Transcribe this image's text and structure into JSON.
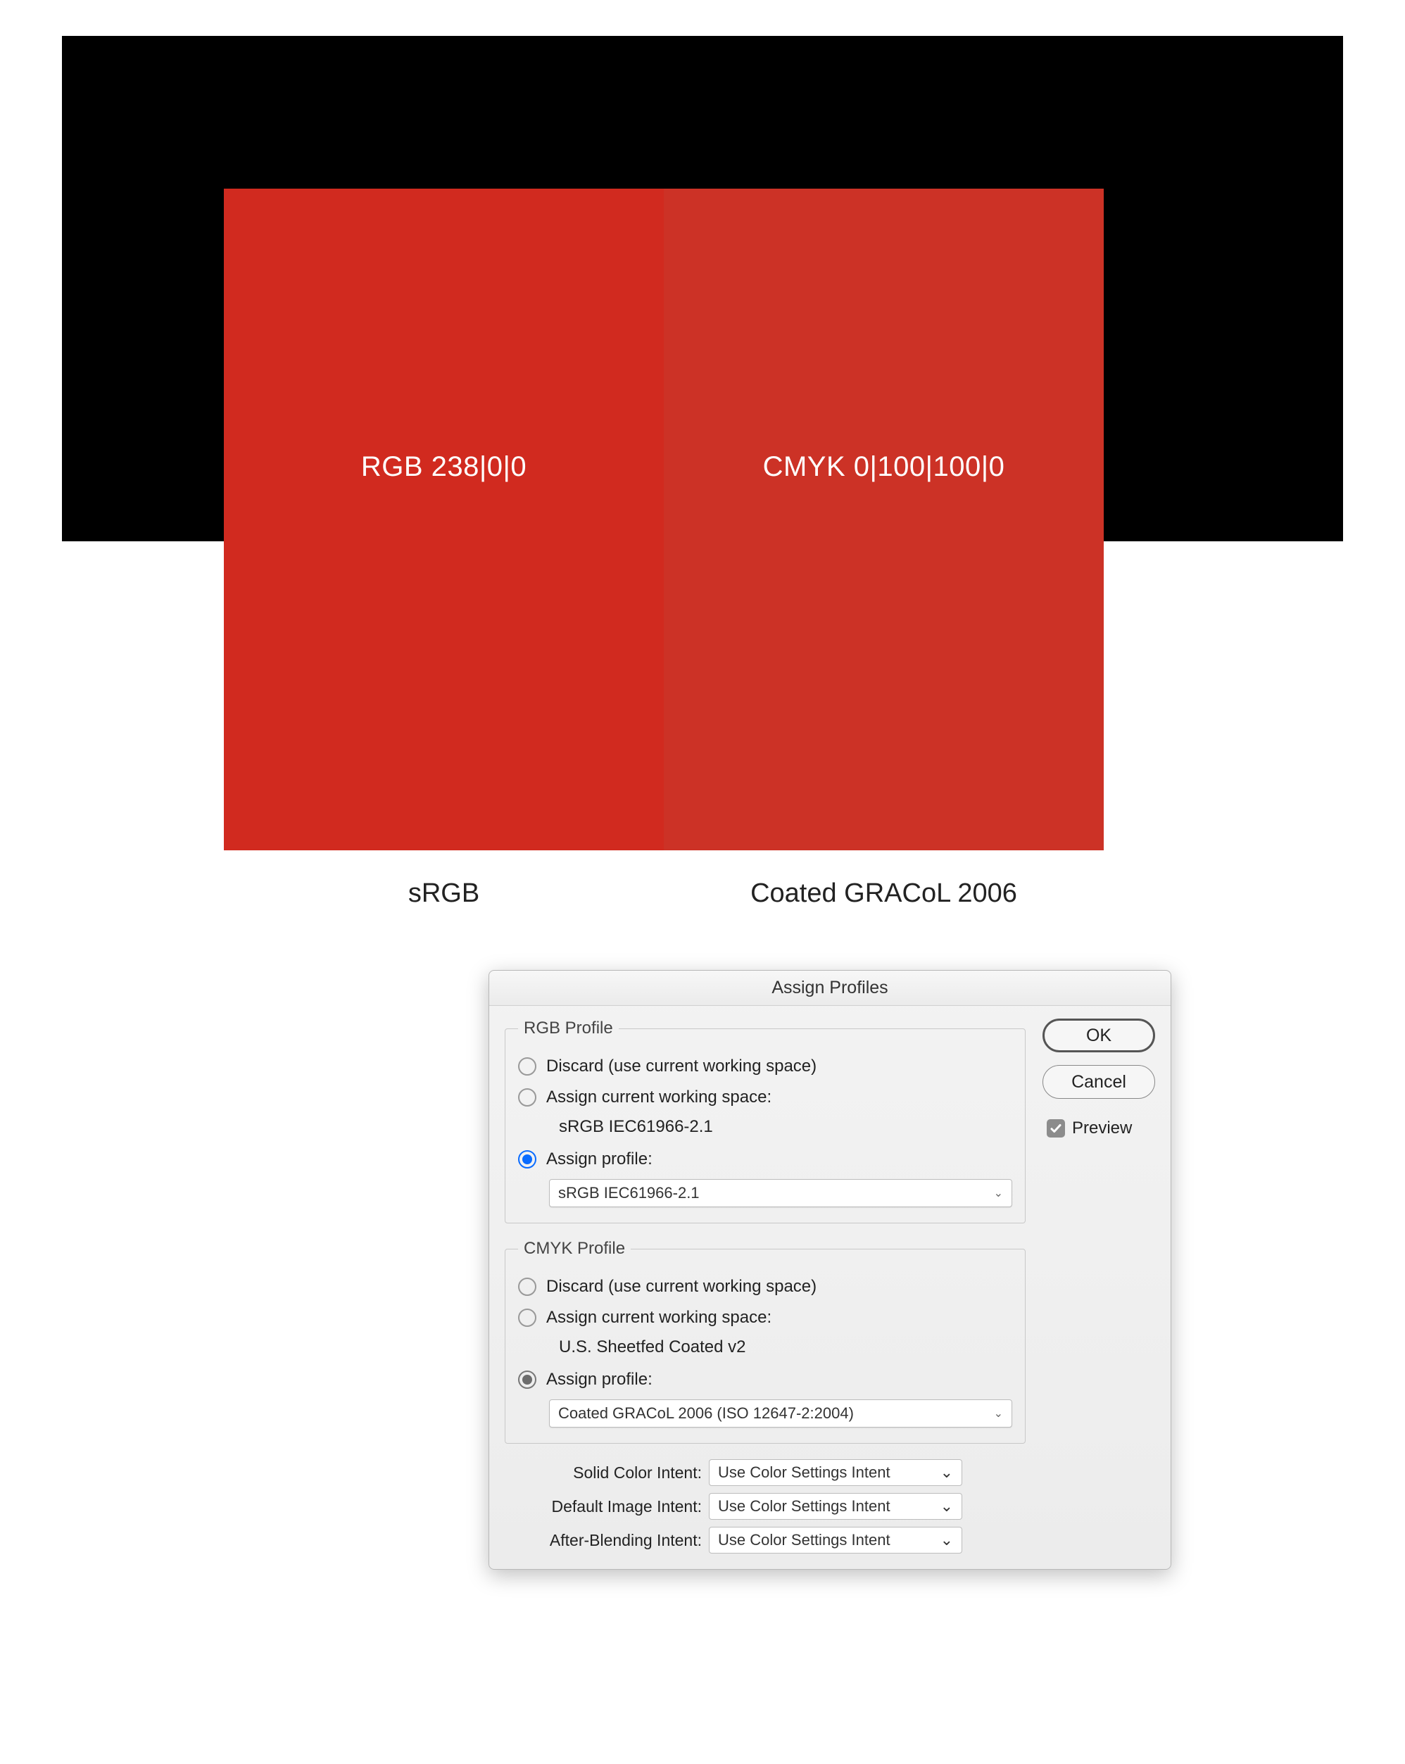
{
  "swatches": {
    "left": {
      "label": "RGB 238|0|0",
      "color": "#d12a1f"
    },
    "right": {
      "label": "CMYK 0|100|100|0",
      "color": "#cc3226"
    }
  },
  "profile_labels": {
    "left": "sRGB",
    "right": "Coated GRACoL 2006"
  },
  "dialog": {
    "title": "Assign Profiles",
    "rgb": {
      "legend": "RGB Profile",
      "discard_label": "Discard (use current working space)",
      "assign_current_label": "Assign current working space:",
      "current_working_space": "sRGB IEC61966-2.1",
      "assign_profile_label": "Assign profile:",
      "selected_profile": "sRGB IEC61966-2.1"
    },
    "cmyk": {
      "legend": "CMYK Profile",
      "discard_label": "Discard (use current working space)",
      "assign_current_label": "Assign current working space:",
      "current_working_space": "U.S. Sheetfed Coated v2",
      "assign_profile_label": "Assign profile:",
      "selected_profile": "Coated GRACoL 2006 (ISO 12647-2:2004)"
    },
    "intents": {
      "solid_label": "Solid Color Intent:",
      "solid_value": "Use Color Settings Intent",
      "image_label": "Default Image Intent:",
      "image_value": "Use Color Settings Intent",
      "blend_label": "After-Blending Intent:",
      "blend_value": "Use Color Settings Intent"
    },
    "buttons": {
      "ok": "OK",
      "cancel": "Cancel",
      "preview": "Preview"
    }
  }
}
